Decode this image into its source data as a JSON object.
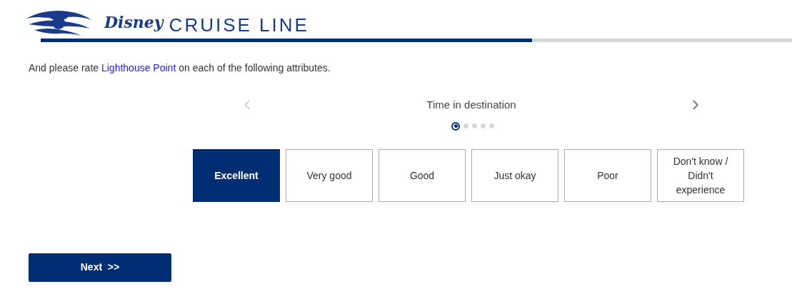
{
  "logo": {
    "brand": "Disney",
    "product": "CRUISE LINE"
  },
  "progress": {
    "level": 0.654
  },
  "prompt": {
    "before": "And please rate ",
    "link": "Lighthouse Point",
    "after": " on each of the following attributes."
  },
  "carousel": {
    "title": "Time in destination",
    "prev_disabled": true,
    "next_disabled": false,
    "dots": [
      {
        "selected": true
      },
      {
        "selected": false
      },
      {
        "selected": false
      },
      {
        "selected": false
      },
      {
        "selected": false
      }
    ]
  },
  "options": [
    {
      "label": "Excellent",
      "selected": true
    },
    {
      "label": "Very good",
      "selected": false
    },
    {
      "label": "Good",
      "selected": false
    },
    {
      "label": "Just okay",
      "selected": false
    },
    {
      "label": "Poor",
      "selected": false
    },
    {
      "label": "Don't know / Didn't experience",
      "selected": false
    }
  ],
  "next_button": "Next  >>"
}
